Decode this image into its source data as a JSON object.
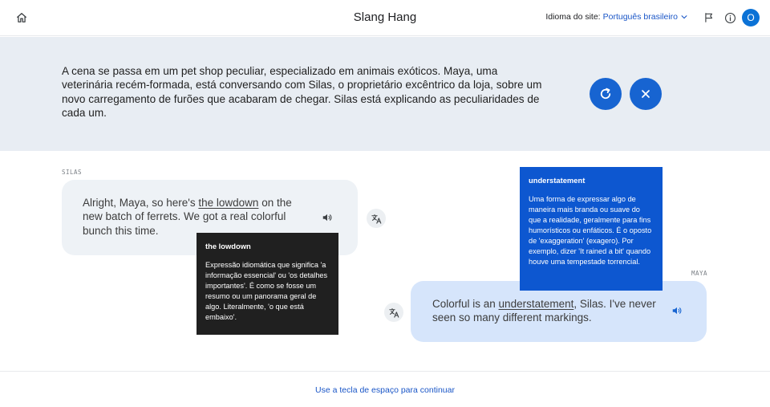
{
  "header": {
    "title": "Slang Hang",
    "language_label": "Idioma do site:",
    "language_value": "Português brasileiro",
    "avatar_initial": "O"
  },
  "scene": {
    "text": "A cena se passa em um pet shop peculiar, especializado em animais exóticos. Maya, uma veterinária recém-formada, está conversando com Silas, o proprietário excêntrico da loja, sobre um novo carregamento de furões que acabaram de chegar. Silas está explicando as peculiaridades de cada um."
  },
  "dialogue": {
    "silas": {
      "speaker": "SILAS",
      "text_before": "Alright, Maya, so here's ",
      "term": "the lowdown",
      "text_after": " on the new batch of ferrets. We got a real colorful bunch this time."
    },
    "maya": {
      "speaker": "MAYA",
      "text_before": "Colorful is an ",
      "term": "understatement",
      "text_after": ", Silas. I've never seen so many different markings."
    }
  },
  "tooltips": {
    "lowdown": {
      "title": "the lowdown",
      "body": "Expressão idiomática que significa 'a informação essencial' ou 'os detalhes importantes'. É como se fosse um resumo ou um panorama geral de algo. Literalmente, 'o que está embaixo'."
    },
    "understatement": {
      "title": "understatement",
      "body": "Uma forma de expressar algo de maneira mais branda ou suave do que a realidade, geralmente para fins humorísticos ou enfáticos. É o oposto de 'exaggeration' (exagero). Por exemplo, dizer 'It rained a bit' quando houve uma tempestade torrencial."
    }
  },
  "footer": {
    "continue": "Use a tecla de espaço para continuar"
  },
  "colors": {
    "accent": "#1764d1",
    "link": "#1a56c7",
    "banner_bg": "#e8edf3",
    "silas_bubble": "#eef2f6",
    "maya_bubble": "#d6e5fb",
    "tooltip_dark": "#202020",
    "tooltip_blue": "#0d57d0"
  },
  "icons": {
    "home": "home-icon",
    "flag": "flag-icon",
    "info": "info-icon",
    "refresh": "refresh-icon",
    "close": "close-icon",
    "speaker": "speaker-icon",
    "translate": "translate-icon"
  }
}
